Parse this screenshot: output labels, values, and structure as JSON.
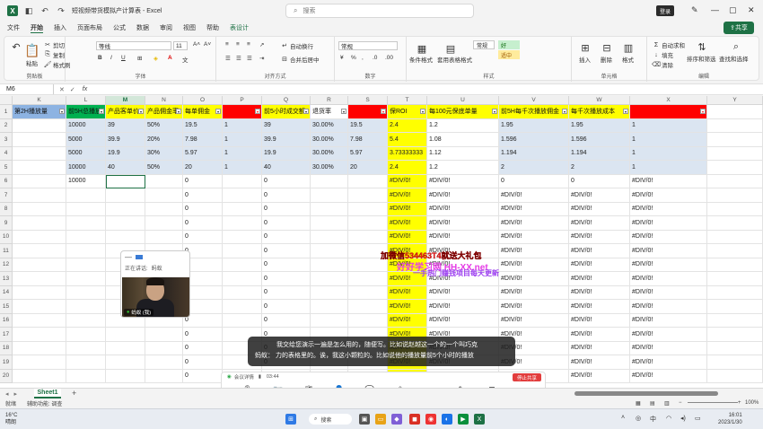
{
  "window": {
    "title": "短视频带货模拟产计算表 - Excel",
    "search_placeholder": "搜索",
    "login_label": "登录"
  },
  "menu": {
    "tabs": [
      "文件",
      "开始",
      "插入",
      "页面布局",
      "公式",
      "数据",
      "审阅",
      "视图",
      "帮助",
      "表设计"
    ],
    "active": "开始",
    "share_label": "共享"
  },
  "ribbon": {
    "clipboard": {
      "label": "剪贴板",
      "paste": "粘贴",
      "cut": "剪切",
      "copy": "复制",
      "format_painter": "格式刷"
    },
    "font": {
      "label": "字体",
      "name": "等线",
      "size": "11",
      "bold": "B",
      "italic": "I",
      "underline": "U"
    },
    "alignment": {
      "label": "对齐方式",
      "wrap": "自动换行",
      "merge": "合并后居中"
    },
    "number": {
      "label": "数字",
      "format": "常规",
      "percent": "%",
      "comma": ","
    },
    "styles": {
      "label": "样式",
      "conditional": "条件格式",
      "table": "套用表格格式",
      "normal": "常规",
      "good": "好",
      "neutral": "适中"
    },
    "cells": {
      "label": "单元格",
      "insert": "插入",
      "delete": "删除",
      "format": "格式"
    },
    "editing": {
      "label": "编辑",
      "autosum": "自动求和",
      "fill": "填充",
      "clear": "清除",
      "sort": "排序和筛选",
      "find": "查找和选择"
    }
  },
  "formula_bar": {
    "name_box": "M6",
    "fx": "fx",
    "content": ""
  },
  "grid": {
    "columns": [
      "K",
      "L",
      "M",
      "N",
      "O",
      "P",
      "Q",
      "R",
      "S",
      "T",
      "U",
      "V",
      "W",
      "X",
      "Y"
    ],
    "selected_column": "M",
    "header_row": [
      "第2H播放量",
      "前5H总播放",
      "产品客单价",
      "产品佣金率",
      "每单佣金",
      "前5H出单数",
      "前5小时成交额",
      "退货率",
      "实际佣金",
      "保ROI",
      "每100元保底单量",
      "前5H每千次播放佣金",
      "每千次播放成本",
      "投流金额(每单)",
      ""
    ],
    "header_colors": [
      "#8db3e2",
      "#00b050",
      "#ffff00",
      "#ffff00",
      "#ffff00",
      "#ff0000",
      "#ffff00",
      "#ffffff",
      "#ff0000",
      "#ffff00",
      "#ffff00",
      "#ffff00",
      "#ffff00",
      "#ff0000",
      "#ffffff"
    ],
    "header_text_colors": [
      "#111",
      "#111",
      "#111",
      "#111",
      "#111",
      "#ff0000",
      "#111",
      "#111",
      "#ff0000",
      "#111",
      "#111",
      "#111",
      "#111",
      "#ff0000",
      "#111"
    ],
    "rows": [
      [
        "",
        "10000",
        "39",
        "50%",
        "19.5",
        "1",
        "39",
        "30.00%",
        "19.5",
        "2.4",
        "1.2",
        "1.95",
        "1.95",
        "1",
        ""
      ],
      [
        "",
        "5000",
        "39.9",
        "20%",
        "7.98",
        "1",
        "39.9",
        "30.00%",
        "7.98",
        "5.4",
        "1.08",
        "1.596",
        "1.596",
        "1",
        ""
      ],
      [
        "",
        "5000",
        "19.9",
        "30%",
        "5.97",
        "1",
        "19.9",
        "30.00%",
        "5.97",
        "3.73333333",
        "1.12",
        "1.194",
        "1.194",
        "1",
        ""
      ],
      [
        "",
        "10000",
        "40",
        "50%",
        "20",
        "1",
        "40",
        "30.00%",
        "20",
        "2.4",
        "1.2",
        "2",
        "2",
        "1",
        ""
      ],
      [
        "",
        "10000",
        "",
        "",
        "0",
        "",
        "0",
        "",
        "",
        "#DIV/0!",
        "#DIV/0!",
        "0",
        "0",
        "#DIV/0!",
        ""
      ],
      [
        "",
        "",
        "",
        "",
        "0",
        "",
        "0",
        "",
        "",
        "#DIV/0!",
        "#DIV/0!",
        "#DIV/0!",
        "#DIV/0!",
        "#DIV/0!",
        ""
      ],
      [
        "",
        "",
        "",
        "",
        "0",
        "",
        "0",
        "",
        "",
        "#DIV/0!",
        "#DIV/0!",
        "#DIV/0!",
        "#DIV/0!",
        "#DIV/0!",
        ""
      ],
      [
        "",
        "",
        "",
        "",
        "0",
        "",
        "0",
        "",
        "",
        "#DIV/0!",
        "#DIV/0!",
        "#DIV/0!",
        "#DIV/0!",
        "#DIV/0!",
        ""
      ],
      [
        "",
        "",
        "",
        "",
        "0",
        "",
        "0",
        "",
        "",
        "#DIV/0!",
        "#DIV/0!",
        "#DIV/0!",
        "#DIV/0!",
        "#DIV/0!",
        ""
      ],
      [
        "",
        "",
        "",
        "",
        "0",
        "",
        "0",
        "",
        "",
        "#DIV/0!",
        "#DIV/0!",
        "#DIV/0!",
        "#DIV/0!",
        "#DIV/0!",
        ""
      ],
      [
        "",
        "",
        "",
        "",
        "0",
        "",
        "0",
        "",
        "",
        "#DIV/0!",
        "#DIV/0!",
        "#DIV/0!",
        "#DIV/0!",
        "#DIV/0!",
        ""
      ],
      [
        "",
        "",
        "",
        "",
        "0",
        "",
        "0",
        "",
        "",
        "#DIV/0!",
        "#DIV/0!",
        "#DIV/0!",
        "#DIV/0!",
        "#DIV/0!",
        ""
      ],
      [
        "",
        "",
        "",
        "",
        "0",
        "",
        "0",
        "",
        "",
        "#DIV/0!",
        "#DIV/0!",
        "#DIV/0!",
        "#DIV/0!",
        "#DIV/0!",
        ""
      ],
      [
        "",
        "",
        "",
        "",
        "0",
        "",
        "0",
        "",
        "",
        "#DIV/0!",
        "#DIV/0!",
        "#DIV/0!",
        "#DIV/0!",
        "#DIV/0!",
        ""
      ],
      [
        "",
        "",
        "",
        "",
        "0",
        "",
        "0",
        "",
        "",
        "#DIV/0!",
        "#DIV/0!",
        "#DIV/0!",
        "#DIV/0!",
        "#DIV/0!",
        ""
      ],
      [
        "",
        "",
        "",
        "",
        "0",
        "",
        "0",
        "",
        "",
        "#DIV/0!",
        "#DIV/0!",
        "#DIV/0!",
        "#DIV/0!",
        "#DIV/0!",
        ""
      ],
      [
        "",
        "",
        "",
        "",
        "0",
        "",
        "0",
        "",
        "",
        "#DIV/0!",
        "#DIV/0!",
        "#DIV/0!",
        "#DIV/0!",
        "#DIV/0!",
        ""
      ],
      [
        "",
        "",
        "",
        "",
        "0",
        "",
        "0",
        "",
        "",
        "#DIV/0!",
        "#DIV/0!",
        "#DIV/0!",
        "#DIV/0!",
        "#DIV/0!",
        ""
      ],
      [
        "",
        "",
        "",
        "",
        "0",
        "",
        "0",
        "",
        "",
        "#DIV/0!",
        "#DIV/0!",
        "#DIV/0!",
        "#DIV/0!",
        "#DIV/0!",
        ""
      ]
    ],
    "row_numbers": [
      "1",
      "2",
      "3",
      "4",
      "5",
      "6",
      "7",
      "8",
      "9",
      "10",
      "11",
      "12",
      "13",
      "14",
      "15",
      "16",
      "17",
      "18",
      "19",
      "20"
    ],
    "col_colors": [
      "#ffffff",
      "#dbe5f1",
      "#dbe5f1",
      "#dbe5f1",
      "#dbe5f1",
      "#dbe5f1",
      "#dbe5f1",
      "#dbe5f1",
      "#dbe5f1",
      "#ffff00",
      "#ffffff",
      "#dbe5f1",
      "#dbe5f1",
      "#dbe5f1",
      "#ffffff"
    ]
  },
  "promo": {
    "line1": "加微信534463T4就送大礼包",
    "line2": "好好学习网 HH-XX.net",
    "line3": "一手热门赚钱项目每天更新"
  },
  "video_panel": {
    "speaking_label": "正在讲话:",
    "speaker": "蚂蚁",
    "name_tag": "蚂蚁 (我)"
  },
  "subtitle": {
    "line1": "我交给您演示一遍是怎么用的，随便写。比如说赵越这一个的一个叫巧克",
    "line2": "蚂蚁：  力的表格里的。诶，我这小颗粒的。比如说他的播放量前5个小时的播放"
  },
  "meeting": {
    "details_label": "会议详情",
    "time": "03:44",
    "stop_share": "停止共享",
    "buttons": [
      "麦克风",
      "摄像头",
      "安全",
      "参会人",
      "聊天",
      "新的共享",
      "录屏",
      "标注",
      "应用",
      "更多"
    ]
  },
  "sheet": {
    "tab": "Sheet1",
    "add": "+"
  },
  "status": {
    "ready": "就绪",
    "accessibility": "辅助功能: 调查",
    "zoom": "100%"
  },
  "taskbar": {
    "weather_temp": "16°C",
    "weather_desc": "晴朗",
    "search": "搜索",
    "time": "16:01",
    "date": "2023/1/30"
  }
}
